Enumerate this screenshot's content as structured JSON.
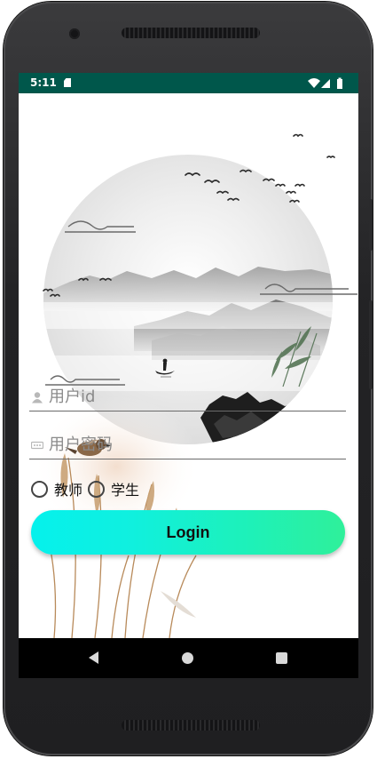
{
  "status_bar": {
    "time": "5:11",
    "background": "#00574b",
    "icons": [
      "sd-card-icon",
      "wifi-icon",
      "signal-icon",
      "battery-icon"
    ]
  },
  "login_form": {
    "user_id_placeholder": "用户id",
    "password_placeholder": "用户密码",
    "role_options": [
      "教师",
      "学生"
    ],
    "role_teacher": "教师",
    "role_student": "学生",
    "login_button": "Login",
    "button_gradient": [
      "#05f1ec",
      "#2ff09a"
    ]
  },
  "background_art": {
    "description_icon": "ink-landscape-icon"
  },
  "nav_bar": {
    "icons": [
      "back-icon",
      "home-icon",
      "recents-icon"
    ]
  }
}
